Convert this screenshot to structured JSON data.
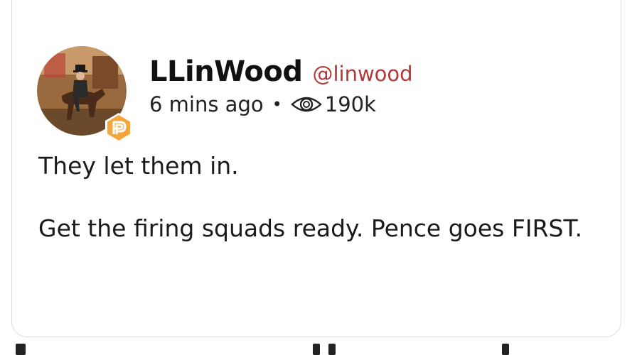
{
  "post": {
    "display_name": "LLinWood",
    "handle": "@linwood",
    "time_ago": "6 mins ago",
    "separator": "•",
    "views": "190k",
    "body_line_1": "They let them in.",
    "body_line_2": "Get the firing squads ready. Pence goes FIRST."
  },
  "icons": {
    "avatar": "profile-photo-horse-rider",
    "badge": "parler-p-badge-icon",
    "views": "eye-icon"
  },
  "colors": {
    "name": "#111111",
    "handle": "#b2373b",
    "badge": "#f3a73b",
    "border": "#d9dde1"
  }
}
